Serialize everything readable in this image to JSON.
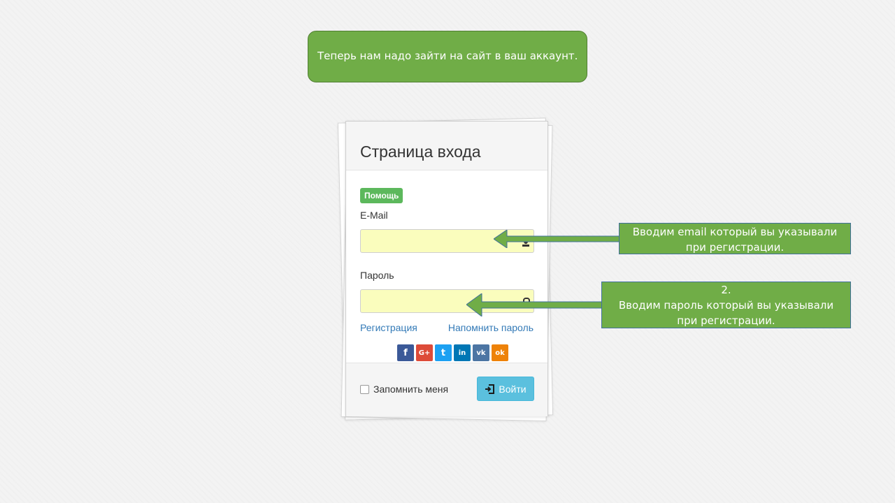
{
  "callouts": {
    "intro": "Теперь нам надо зайти на сайт в ваш аккаунт.",
    "email_line1": "Вводим email который вы указывали",
    "email_line2": "при регистрации.",
    "pass_line1": "2.",
    "pass_line2": "Вводим пароль который вы указывали",
    "pass_line3": "при регистрации."
  },
  "login": {
    "title": "Страница входа",
    "help_badge": "Помощь",
    "email_label": "E-Mail",
    "email_value": "",
    "password_label": "Пароль",
    "password_value": "",
    "register_link": "Регистрация",
    "remind_link": "Напомнить пароль",
    "remember_label": "Запомнить меня",
    "remember_checked": false,
    "login_button": "Войти"
  },
  "socials": [
    {
      "name": "facebook-icon",
      "glyph": "f",
      "color": "#3b5998"
    },
    {
      "name": "google-plus-icon",
      "glyph": "G+",
      "color": "#dd4b39"
    },
    {
      "name": "twitter-icon",
      "glyph": "t",
      "color": "#1da1f2"
    },
    {
      "name": "linkedin-icon",
      "glyph": "in",
      "color": "#0077b5"
    },
    {
      "name": "vk-icon",
      "glyph": "vk",
      "color": "#4c75a3"
    },
    {
      "name": "odnoklassniki-icon",
      "glyph": "ok",
      "color": "#ee8208"
    }
  ],
  "colors": {
    "callout_fill": "#70ad47",
    "badge": "#5cb85c",
    "login_button": "#5bc0de",
    "link": "#337ab7",
    "autofill": "#fafdbd"
  }
}
